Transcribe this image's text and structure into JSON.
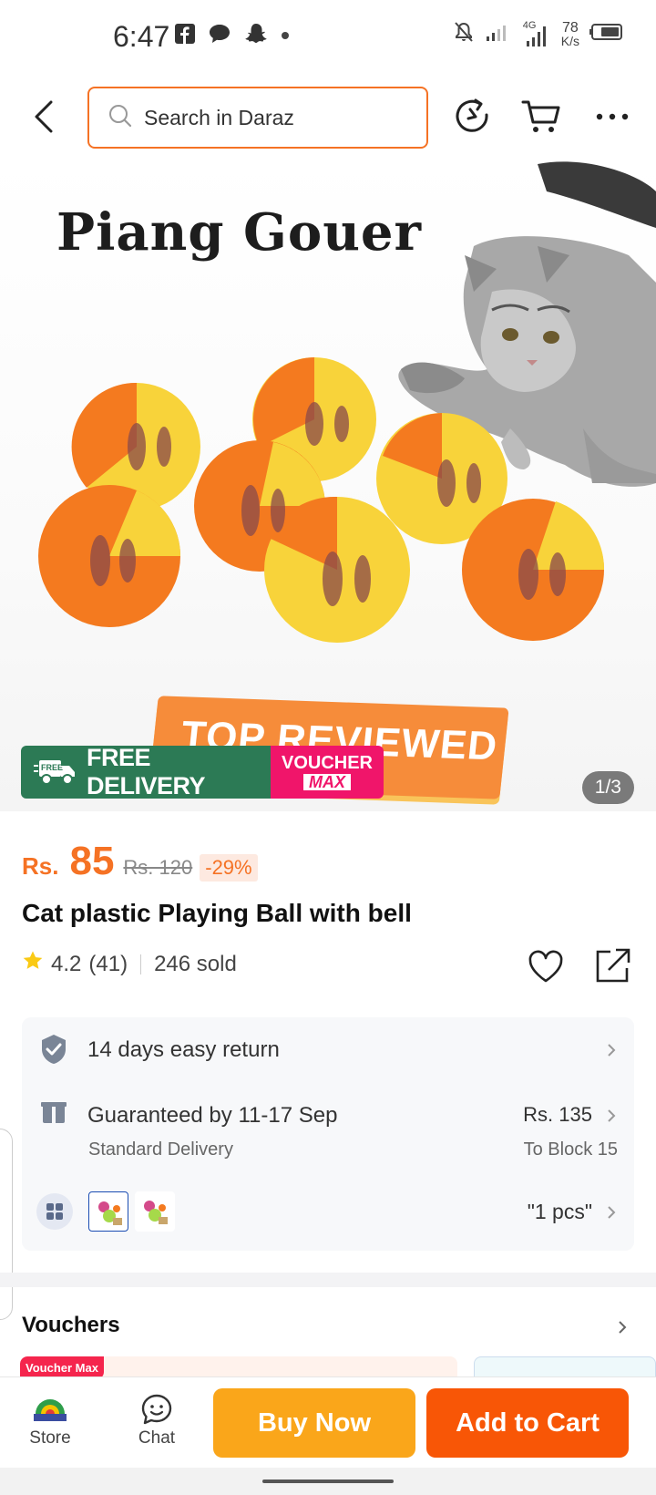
{
  "status_bar": {
    "time": "6:47",
    "network": "4G",
    "speed_value": "78",
    "speed_unit": "K/s"
  },
  "header": {
    "search_placeholder": "Search in Daraz"
  },
  "hero": {
    "brand": "Piang Gouer",
    "top_reviewed": "TOP REVIEWED",
    "free_delivery_tag": "FREE",
    "free_delivery": "FREE DELIVERY",
    "voucher_line1": "VOUCHER",
    "voucher_line2": "MAX",
    "image_counter": "1/3"
  },
  "product": {
    "currency": "Rs.",
    "price": "85",
    "old_price": "Rs. 120",
    "discount": "-29%",
    "title": "Cat plastic Playing Ball with bell",
    "rating": "4.2",
    "review_count": "(41)",
    "sold": "246 sold"
  },
  "info": {
    "return": "14 days easy return",
    "delivery_main": "Guaranteed by 11-17 Sep",
    "delivery_sub": "Standard Delivery",
    "delivery_price": "Rs. 135",
    "delivery_location": "To Block 15",
    "variant": "\"1 pcs\""
  },
  "vouchers": {
    "title": "Vouchers",
    "tag": "Voucher Max"
  },
  "bottom_bar": {
    "store": "Store",
    "chat": "Chat",
    "buy_now": "Buy Now",
    "add_to_cart": "Add to Cart"
  },
  "colors": {
    "accent": "#f57224",
    "buy": "#faa61a",
    "cart": "#f85606",
    "free_delivery": "#2c7a55",
    "voucher": "#f0156a"
  }
}
